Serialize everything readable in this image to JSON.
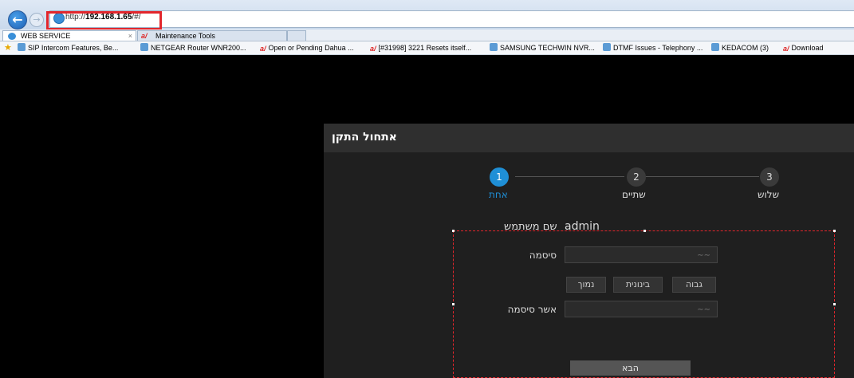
{
  "browser": {
    "url": "http://192.168.1.65/#/",
    "url_host": "192.168.1.65",
    "tabs": [
      {
        "label": "WEB SERVICE",
        "close": "×"
      },
      {
        "label": "Maintenance Tools"
      }
    ],
    "favorites": [
      "SIP Intercom Features, Be...",
      "NETGEAR Router WNR200...",
      "Open or Pending Dahua ...",
      "[#31998] 3221 Resets itself...",
      "SAMSUNG TECHWIN NVR...",
      "DTMF Issues - Telephony ...",
      "KEDACOM (3)",
      "Download"
    ],
    "highlight_color": "#e2262c"
  },
  "dialog": {
    "title": "אתחול התקן",
    "steps": [
      {
        "number": "1",
        "label": "אחת",
        "active": true
      },
      {
        "number": "2",
        "label": "שתיים",
        "active": false
      },
      {
        "number": "3",
        "label": "שלוש",
        "active": false
      }
    ],
    "username_label": "שם משתמש",
    "username_value": "admin",
    "password_label": "סיסמה",
    "confirm_label": "אשר סיסמה",
    "strength": {
      "high": "גבוה",
      "medium": "בינונית",
      "low": "נמוך"
    },
    "next_button": "הבא",
    "accent_color": "#1f8fd6"
  }
}
